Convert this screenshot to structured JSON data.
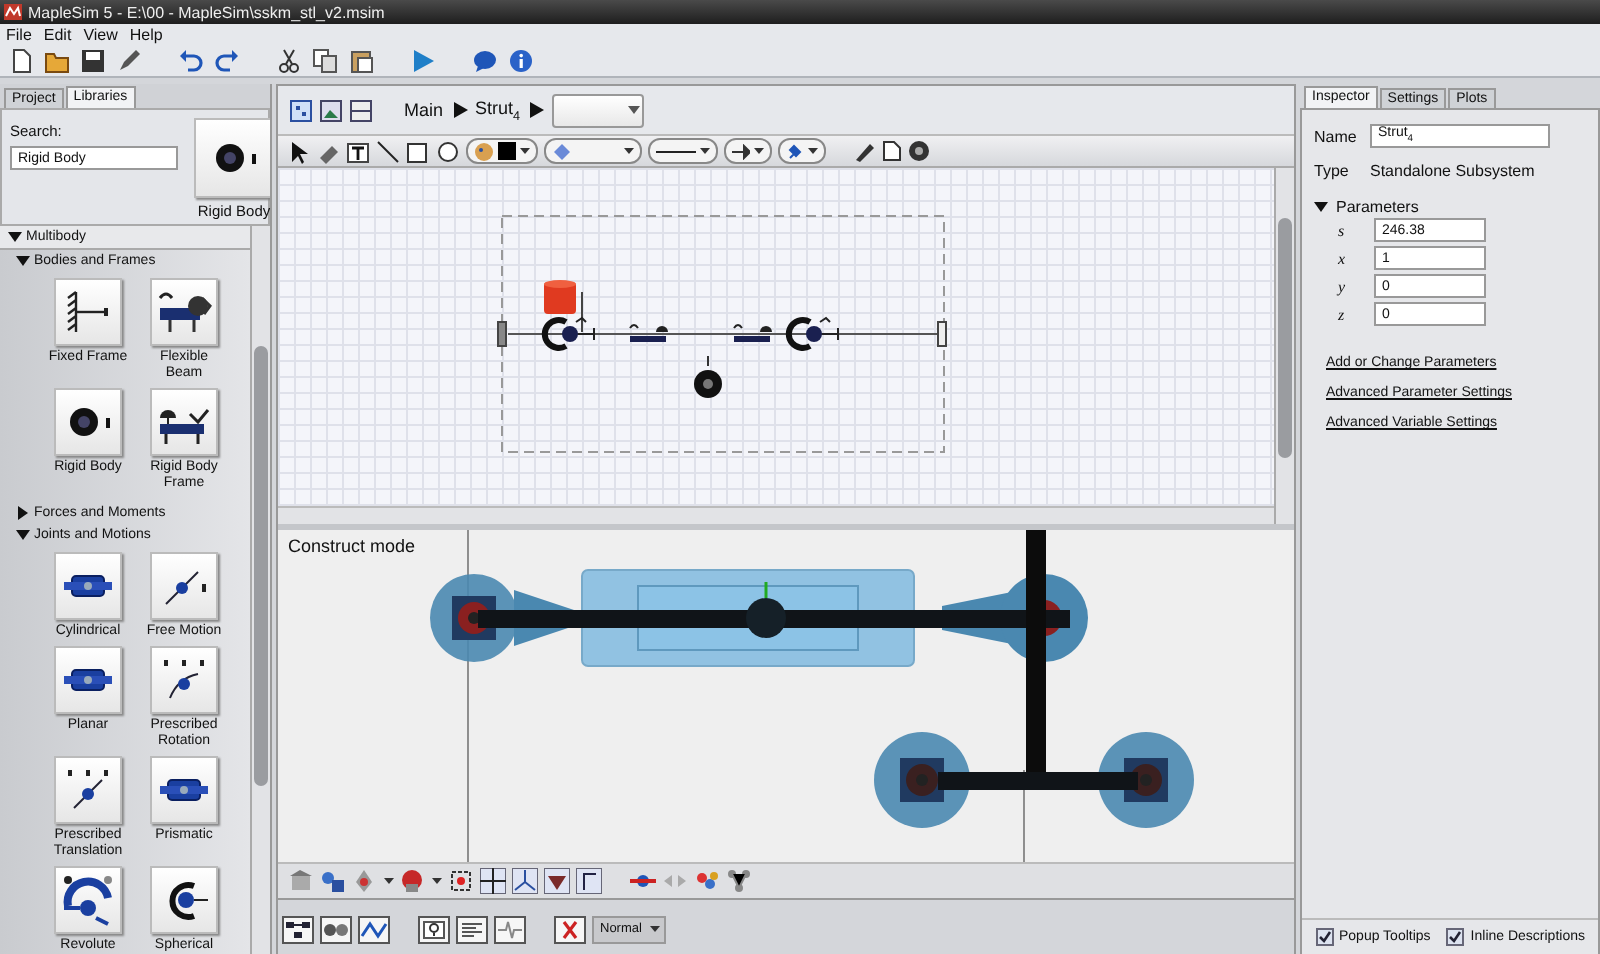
{
  "window": {
    "title": "MapleSim 5 - E:\\00 - MapleSim\\sskm_stl_v2.msim"
  },
  "menu": [
    "File",
    "Edit",
    "View",
    "Help"
  ],
  "left_panel": {
    "tabs": [
      {
        "label": "Project",
        "selected": false
      },
      {
        "label": "Libraries",
        "selected": true
      }
    ],
    "search": {
      "label": "Search:",
      "value": "Rigid Body"
    },
    "preview": {
      "label": "Rigid Body"
    },
    "library": {
      "label": "Multibody",
      "expanded": true,
      "children": [
        {
          "label": "Bodies and Frames",
          "expanded": true,
          "children": [
            {
              "label": "Fixed Frame"
            },
            {
              "label": "Flexible Beam"
            },
            {
              "label": "Rigid Body"
            },
            {
              "label": "Rigid Body Frame"
            }
          ]
        },
        {
          "label": "Forces and Moments",
          "expanded": false
        },
        {
          "label": "Joints and Motions",
          "expanded": true,
          "children": [
            {
              "label": "Cylindrical"
            },
            {
              "label": "Free Motion"
            },
            {
              "label": "Planar"
            },
            {
              "label": "Prescribed Rotation"
            },
            {
              "label": "Prescribed Translation"
            },
            {
              "label": "Prismatic"
            },
            {
              "label": "Revolute"
            },
            {
              "label": "Spherical"
            }
          ]
        }
      ]
    }
  },
  "breadcrumb": [
    {
      "label": "Main"
    },
    {
      "label": "Strut$_{4}$"
    }
  ],
  "view_3d": {
    "label": "Construct mode"
  },
  "bottom_bar": {
    "mode": "Normal"
  },
  "inspector": {
    "tabs": [
      {
        "label": "Inspector",
        "selected": true
      },
      {
        "label": "Settings",
        "selected": false
      },
      {
        "label": "Plots",
        "selected": false
      }
    ],
    "name": {
      "label": "Name",
      "value": "Strut$_{4}$"
    },
    "type": {
      "label": "Type",
      "value": "Standalone Subsystem"
    },
    "parameters": {
      "label": "Parameters",
      "expanded": true,
      "rows": [
        {
          "name": "s",
          "value": "246.38"
        },
        {
          "name": "x",
          "value": "1"
        },
        {
          "name": "y",
          "value": "0"
        },
        {
          "name": "z",
          "value": "0"
        }
      ]
    },
    "links": [
      "Add or Change Parameters",
      "Advanced Parameter Settings",
      "Advanced Variable Settings"
    ],
    "options": [
      {
        "label": "Popup Tooltips",
        "checked": true
      },
      {
        "label": "Inline Descriptions",
        "checked": true
      }
    ]
  }
}
